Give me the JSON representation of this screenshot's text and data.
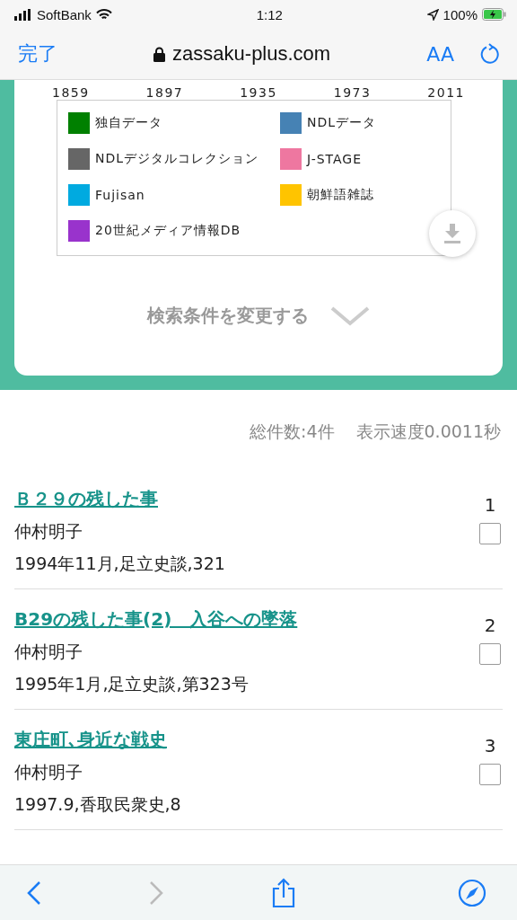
{
  "status_bar": {
    "carrier": "SoftBank",
    "time": "1:12",
    "battery": "100%"
  },
  "address_bar": {
    "done": "完了",
    "url": "zassaku-plus.com",
    "text_size": "AA"
  },
  "chart": {
    "axis_years": [
      "1859",
      "1897",
      "1935",
      "1973",
      "2011"
    ],
    "legend": [
      {
        "label": "独自データ",
        "color": "#008000"
      },
      {
        "label": "NDLデータ",
        "color": "#4682b4"
      },
      {
        "label": "NDLデジタルコレクション",
        "color": "#666666"
      },
      {
        "label": "J-STAGE",
        "color": "#ee77a0"
      },
      {
        "label": "Fujisan",
        "color": "#00aae0"
      },
      {
        "label": "朝鮮語雑誌",
        "color": "#ffc400"
      },
      {
        "label": "20世紀メディア情報DB",
        "color": "#9933cc"
      }
    ]
  },
  "change_conditions": "検索条件を変更する",
  "summary": {
    "count": "総件数:4件",
    "speed": "表示速度0.0011秒"
  },
  "results": [
    {
      "title": "Ｂ２９の残した事",
      "author": "仲村明子",
      "detail": "1994年11月,足立史談,321",
      "number": "1",
      "checked": false
    },
    {
      "title": "B29の残した事(2)　入谷への墜落",
      "author": "仲村明子",
      "detail": "1995年1月,足立史談,第323号",
      "number": "2",
      "checked": false
    },
    {
      "title": "東庄町､身近な戦史",
      "author": "仲村明子",
      "detail": "1997.9,香取民衆史,8",
      "number": "3",
      "checked": false
    }
  ]
}
